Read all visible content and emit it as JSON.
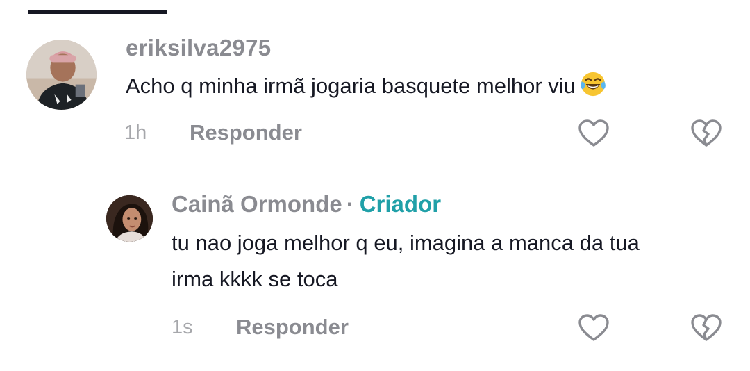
{
  "comments": [
    {
      "username": "eriksilva2975",
      "text": "Acho q minha irmã jogaria basquete melhor viu",
      "emoji": "face-with-tears-of-joy-emoji",
      "time": "1h",
      "reply_label": "Responder",
      "like_icon": "heart-outline-icon",
      "dislike_icon": "broken-heart-icon"
    }
  ],
  "reply": {
    "author": "Cainã Ormonde",
    "separator": "·",
    "badge": "Criador",
    "text_line1": "tu nao joga melhor q eu, imagina a manca da tua",
    "text_line2": "irma kkkk se toca",
    "time": "1s",
    "reply_label": "Responder",
    "like_icon": "heart-outline-icon",
    "dislike_icon": "broken-heart-icon"
  },
  "colors": {
    "text_primary": "#161823",
    "text_secondary": "#8a8b91",
    "creator_badge": "#20a0a8",
    "tab_indicator": "#161823"
  }
}
